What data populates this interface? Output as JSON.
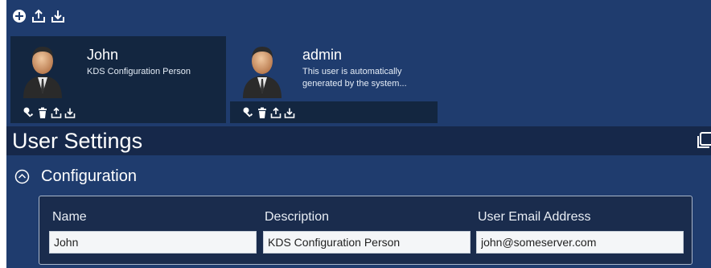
{
  "toolbar": {
    "icons": [
      "add-circle-icon",
      "upload-icon",
      "download-icon"
    ]
  },
  "users": [
    {
      "name": "John",
      "description": "KDS Configuration Person",
      "selected": true,
      "actions": [
        "key-icon",
        "trash-icon",
        "upload-icon",
        "download-icon"
      ]
    },
    {
      "name": "admin",
      "description": "This user is automatically generated by the system...",
      "selected": false,
      "actions": [
        "key-icon",
        "trash-icon",
        "upload-icon",
        "download-icon"
      ]
    }
  ],
  "settings": {
    "title": "User Settings",
    "copy_icon": "copy-window-icon"
  },
  "configuration": {
    "title": "Configuration",
    "expanded": true,
    "fields": {
      "name": {
        "label": "Name",
        "value": "John"
      },
      "description": {
        "label": "Description",
        "value": "KDS Configuration Person"
      },
      "email": {
        "label": "User Email Address",
        "value": "john@someserver.com"
      }
    }
  },
  "colors": {
    "background": "#1f3c6e",
    "panel_dark": "#132640",
    "settings_bar": "#16284a",
    "input_bg": "#f4f6f8"
  }
}
